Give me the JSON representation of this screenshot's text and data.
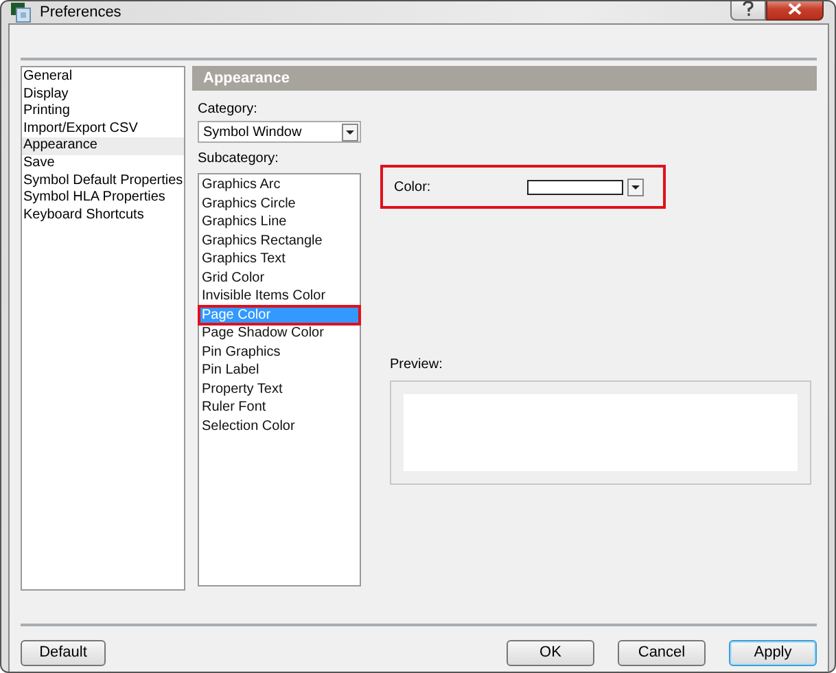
{
  "window": {
    "title": "Preferences"
  },
  "sidebar": {
    "items": [
      {
        "label": "General",
        "selected": false
      },
      {
        "label": "Display",
        "selected": false
      },
      {
        "label": "Printing",
        "selected": false
      },
      {
        "label": "Import/Export CSV",
        "selected": false
      },
      {
        "label": "Appearance",
        "selected": true
      },
      {
        "label": "Save",
        "selected": false
      },
      {
        "label": "Symbol Default Properties",
        "selected": false
      },
      {
        "label": "Symbol HLA Properties",
        "selected": false
      },
      {
        "label": "Keyboard Shortcuts",
        "selected": false
      }
    ]
  },
  "panel": {
    "title": "Appearance",
    "category": {
      "label": "Category:",
      "value": "Symbol Window"
    },
    "subcategory": {
      "label": "Subcategory:",
      "items": [
        {
          "label": "Graphics Arc",
          "selected": false,
          "highlighted": false
        },
        {
          "label": "Graphics Circle",
          "selected": false,
          "highlighted": false
        },
        {
          "label": "Graphics Line",
          "selected": false,
          "highlighted": false
        },
        {
          "label": "Graphics Rectangle",
          "selected": false,
          "highlighted": false
        },
        {
          "label": "Graphics Text",
          "selected": false,
          "highlighted": false
        },
        {
          "label": "Grid Color",
          "selected": false,
          "highlighted": false
        },
        {
          "label": "Invisible Items Color",
          "selected": false,
          "highlighted": false
        },
        {
          "label": "Page Color",
          "selected": true,
          "highlighted": true
        },
        {
          "label": "Page Shadow Color",
          "selected": false,
          "highlighted": false
        },
        {
          "label": "Pin Graphics",
          "selected": false,
          "highlighted": false
        },
        {
          "label": "Pin Label",
          "selected": false,
          "highlighted": false
        },
        {
          "label": "Property Text",
          "selected": false,
          "highlighted": false
        },
        {
          "label": "Ruler Font",
          "selected": false,
          "highlighted": false
        },
        {
          "label": "Selection Color",
          "selected": false,
          "highlighted": false
        }
      ]
    },
    "color": {
      "label": "Color:",
      "color": "#ffffff",
      "highlighted": true
    },
    "preview": {
      "label": "Preview:"
    }
  },
  "buttons": [
    {
      "label": "Default",
      "kind": "left",
      "focused": false
    },
    {
      "label": "OK",
      "kind": "right",
      "focused": false
    },
    {
      "label": "Cancel",
      "kind": "right",
      "focused": false
    },
    {
      "label": "Apply",
      "kind": "right",
      "focused": true
    }
  ]
}
